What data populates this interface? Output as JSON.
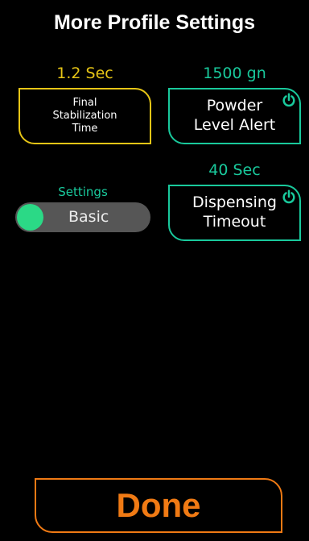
{
  "title": "More Profile Settings",
  "colors": {
    "yellow": "#e6c516",
    "green": "#19c99c",
    "orange": "#f07a14",
    "toggle_bg": "#565656",
    "knob": "#2bd986"
  },
  "tiles": [
    {
      "value": "1.2 Sec",
      "label": "Final\nStabilization\nTime",
      "accent": "yellow",
      "icon": null
    },
    {
      "value": "1500 gn",
      "label": "Powder\nLevel Alert",
      "accent": "green",
      "icon": "power-icon"
    },
    {
      "value": "40 Sec",
      "label": "Dispensing\nTimeout",
      "accent": "green",
      "icon": "power-icon"
    }
  ],
  "settings": {
    "label": "Settings",
    "mode": "Basic"
  },
  "done_label": "Done"
}
